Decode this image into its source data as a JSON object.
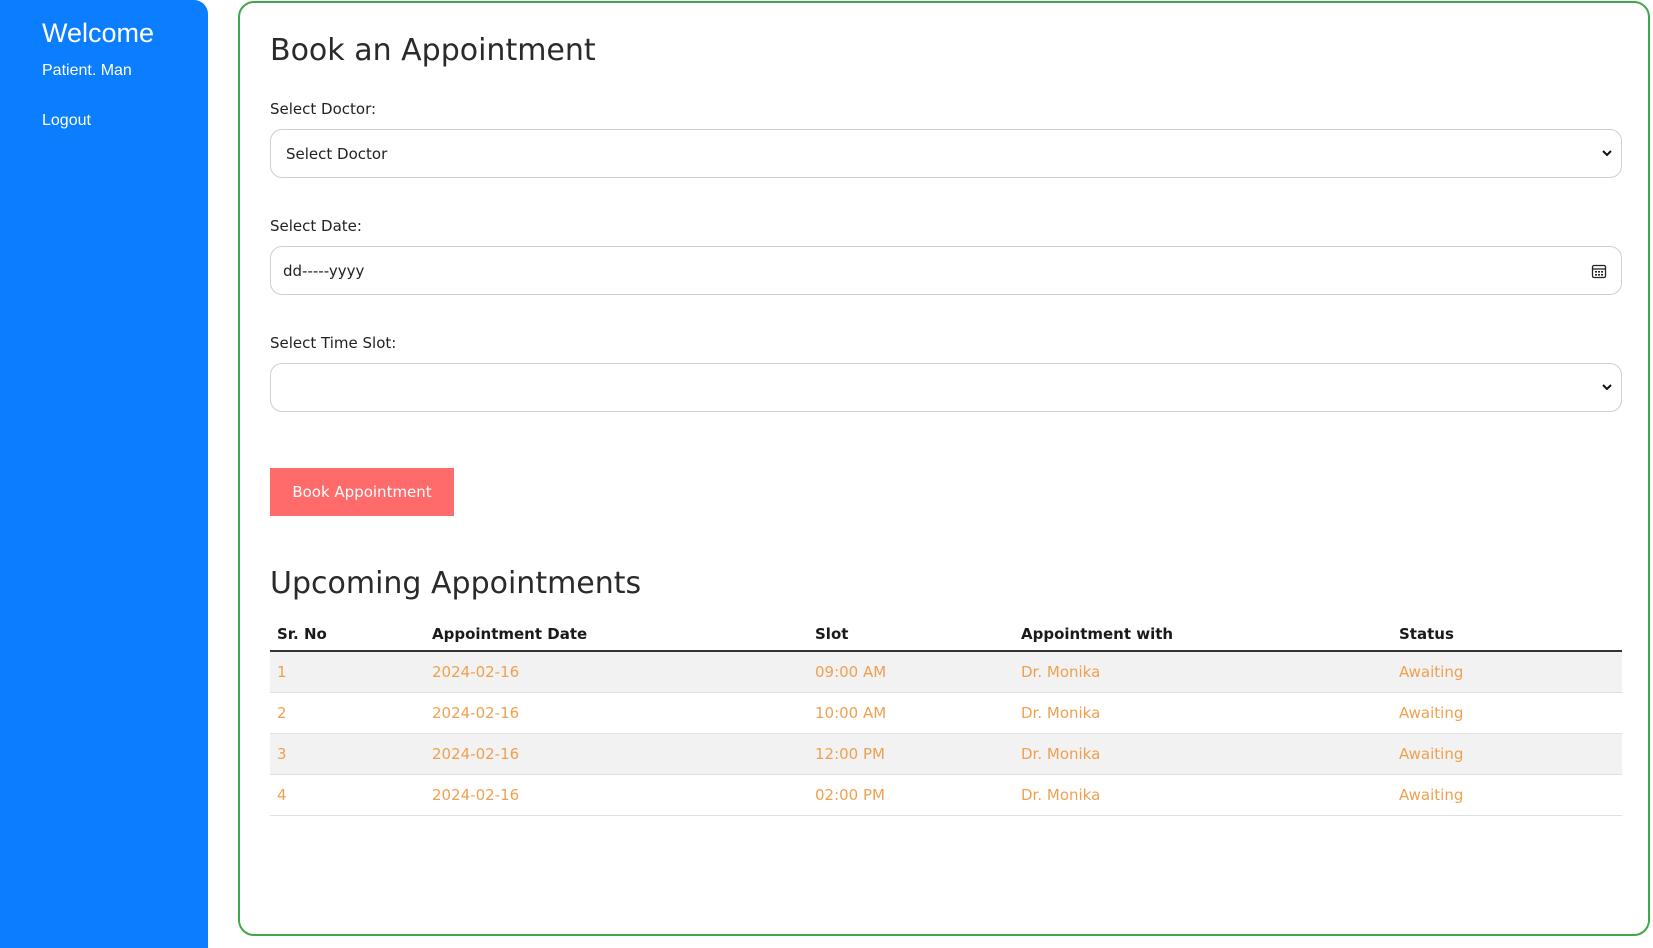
{
  "sidebar": {
    "welcome": "Welcome",
    "user_name": "Patient. Man",
    "logout": "Logout",
    "background_color": "#0b7dff"
  },
  "form": {
    "title": "Book an Appointment",
    "doctor_label": "Select Doctor:",
    "doctor_value": "Select Doctor",
    "date_label": "Select Date:",
    "date_value": "dd-----yyyy",
    "slot_label": "Select Time Slot:",
    "slot_value": "",
    "book_button": "Book Appointment",
    "button_color": "#ff6b6b"
  },
  "appointments": {
    "title": "Upcoming Appointments",
    "columns": [
      "Sr. No",
      "Appointment Date",
      "Slot",
      "Appointment with",
      "Status"
    ],
    "rows": [
      [
        "1",
        "2024-02-16",
        "09:00 AM",
        "Dr. Monika",
        "Awaiting"
      ],
      [
        "2",
        "2024-02-16",
        "10:00 AM",
        "Dr. Monika",
        "Awaiting"
      ],
      [
        "3",
        "2024-02-16",
        "12:00 PM",
        "Dr. Monika",
        "Awaiting"
      ],
      [
        "4",
        "2024-02-16",
        "02:00 PM",
        "Dr. Monika",
        "Awaiting"
      ]
    ],
    "row_text_color": "#f0a050"
  },
  "icons": {
    "select_chevron": "chevron-down-icon",
    "date_picker": "calendar-icon"
  }
}
